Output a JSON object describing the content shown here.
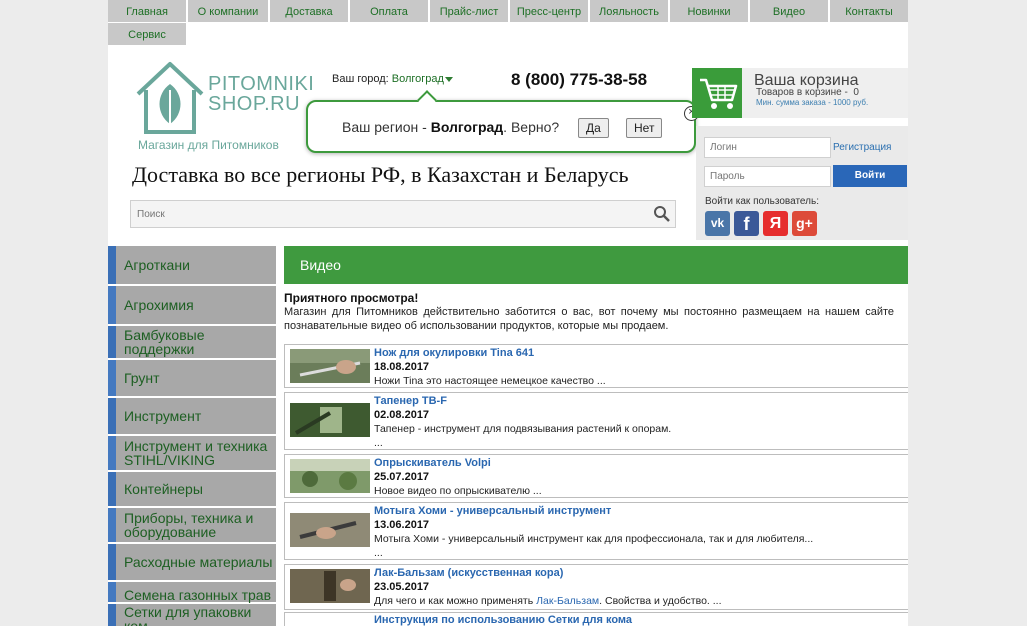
{
  "nav": {
    "items": [
      "Главная",
      "О компании",
      "Доставка",
      "Оплата",
      "Прайс-лист",
      "Пресс-центр",
      "Лояльность",
      "Новинки",
      "Видео",
      "Контакты",
      "Сервис"
    ]
  },
  "logo": {
    "line1": "PITOMNIKI",
    "line2": "SHOP.RU",
    "subtitle": "Магазин для Питомников"
  },
  "city": {
    "label": "Ваш город:",
    "value": "Волгоград"
  },
  "phone": "8 (800) 775-38-58",
  "region_popup": {
    "text_before": "Ваш регион - ",
    "region": "Волгоград",
    "text_after": ". Верно?",
    "yes_label": "Да",
    "no_label": "Нет",
    "close_symbol": "×"
  },
  "tagline": "Доставка во все регионы РФ, в Казахстан и Беларусь",
  "search": {
    "placeholder": "Поиск"
  },
  "cart": {
    "title": "Ваша корзина",
    "count_label": "Товаров в корзине -",
    "count": "0",
    "min_order": "Мин. сумма заказа - 1000 руб."
  },
  "login": {
    "login_placeholder": "Логин",
    "password_placeholder": "Пароль",
    "register_label": "Регистрация",
    "submit_label": "Войти",
    "social_label": "Войти как пользователь:",
    "social": [
      {
        "name": "vk",
        "glyph": "vk",
        "color": "#4a76a8"
      },
      {
        "name": "facebook",
        "glyph": "f",
        "color": "#3b5998"
      },
      {
        "name": "yandex",
        "glyph": "Я",
        "color": "#e62e2e"
      },
      {
        "name": "google-plus",
        "glyph": "g+",
        "color": "#dd4b39"
      }
    ]
  },
  "sidebar": {
    "items": [
      "Агроткани",
      "Агрохимия",
      "Бамбуковые поддержки",
      "Грунт",
      "Инструмент",
      "Инструмент и техника STIHL/VIKING",
      "Контейнеры",
      "Приборы, техника и оборудование",
      "Расходные материалы",
      "Семена газонных трав",
      "Сетки для упаковки ком..."
    ]
  },
  "content": {
    "heading": "Видео",
    "intro_title": "Приятного просмотра!",
    "intro_text": "Магазин для Питомников действительно заботится о вас, вот почему мы постоянно размещаем на нашем сайте познавательные видео об использовании продуктов, которые мы продаем.",
    "videos": [
      {
        "title": "Нож для окулировки Tina 641",
        "date": "18.08.2017",
        "desc": "Ножи Tina это настоящее немецкое качество ...",
        "more": ""
      },
      {
        "title": "Тапенер TB-F",
        "date": "02.08.2017",
        "desc": "Тапенер - инструмент для подвязывания растений к опорам.",
        "more": "..."
      },
      {
        "title": "Опрыскиватель Volpi",
        "date": "25.07.2017",
        "desc": "Новое видео по опрыскивателю ...",
        "more": ""
      },
      {
        "title": "Мотыга Хоми - универсальный инструмент",
        "date": "13.06.2017",
        "desc": "Мотыга Хоми - универсальный инструмент как для профессионала, так и для любителя...",
        "more": "..."
      },
      {
        "title": "Лак-Бальзам (искусственная кора)",
        "date": "23.05.2017",
        "desc_before": "Для чего и как можно применять ",
        "desc_link": "Лак-Бальзам",
        "desc_after": ". Свойства и удобство. ...",
        "more": ""
      },
      {
        "title": "Инструкция по использованию Сетки для кома",
        "date": "",
        "desc": "",
        "more": ""
      }
    ]
  }
}
